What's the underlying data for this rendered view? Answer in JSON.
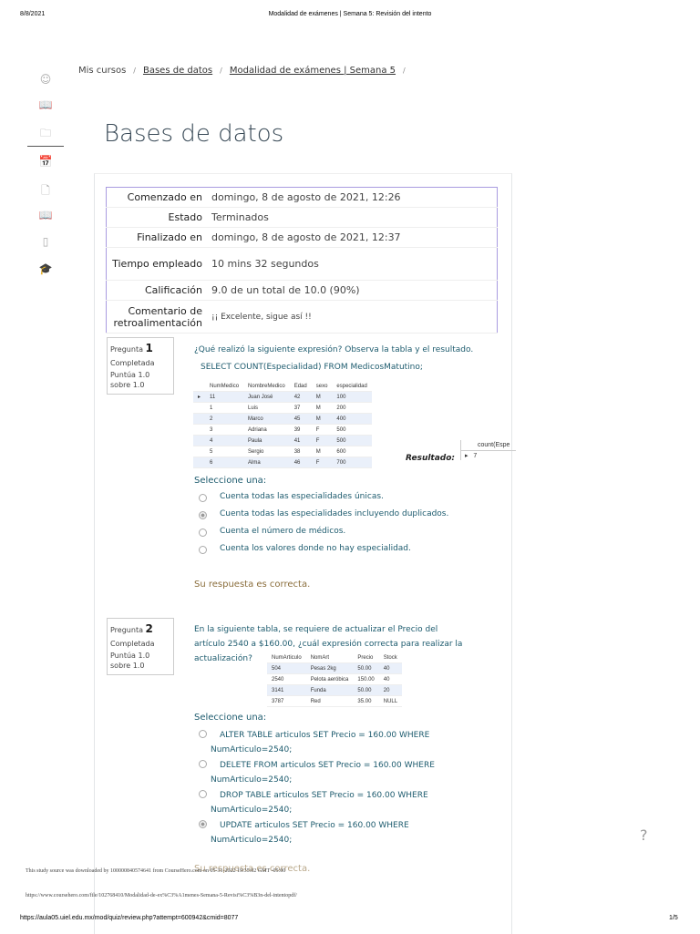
{
  "header": {
    "date": "8/8/2021",
    "title": "Modalidad de exámenes | Semana 5: Revisión del intento"
  },
  "breadcrumb": [
    "Mis cursos",
    "Bases de datos",
    "Modalidad de exámenes | Semana 5"
  ],
  "sidebar_icons": [
    "user-icon",
    "book-icon",
    "folder-icon",
    "calendar-icon",
    "files-icon",
    "library-icon",
    "mobile-icon",
    "graduation-cap-icon"
  ],
  "page_title": "Bases de datos",
  "summary": [
    {
      "k": "Comenzado en",
      "v": "domingo, 8 de agosto de 2021, 12:26"
    },
    {
      "k": "Estado",
      "v": "Terminados"
    },
    {
      "k": "Finalizado en",
      "v": "domingo, 8 de agosto de 2021, 12:37"
    },
    {
      "k": "Tiempo empleado",
      "v": "10 mins 32 segundos"
    },
    {
      "k": "Calificación",
      "v": "9.0 de un total de 10.0 (90%)"
    },
    {
      "k": "Comentario de retroalimentación",
      "v": "¡¡ Excelente, sigue así !!"
    }
  ],
  "q1": {
    "label": "Pregunta",
    "num": "1",
    "status": "Completada",
    "score": "Puntúa 1.0 sobre 1.0",
    "text": "¿Qué realizó la siguiente expresión? Observa la tabla y el resultado.",
    "sql": "SELECT COUNT(Especialidad)  FROM MedicosMatutino;",
    "headers": [
      "NumMedico",
      "NombreMedico",
      "Edad",
      "sexo",
      "especialidad"
    ],
    "rows": [
      [
        "11",
        "Juan José",
        "42",
        "M",
        "100"
      ],
      [
        "1",
        "Luis",
        "37",
        "M",
        "200"
      ],
      [
        "2",
        "Marco",
        "45",
        "M",
        "400"
      ],
      [
        "3",
        "Adriana",
        "39",
        "F",
        "500"
      ],
      [
        "4",
        "Paula",
        "41",
        "F",
        "500"
      ],
      [
        "5",
        "Sergio",
        "38",
        "M",
        "600"
      ],
      [
        "6",
        "Alma",
        "46",
        "F",
        "700"
      ]
    ],
    "result_label": "Resultado:",
    "result_header": "count(Espe",
    "result_value": "7",
    "select": "Seleccione una:",
    "options": [
      "Cuenta todas las especialidades únicas.",
      "Cuenta todas las especialidades incluyendo duplicados.",
      "Cuenta el número de médicos.",
      "Cuenta los valores donde no hay especialidad."
    ],
    "selected": 1,
    "feedback": "Su respuesta es correcta."
  },
  "q2": {
    "label": "Pregunta",
    "num": "2",
    "status": "Completada",
    "score": "Puntúa 1.0 sobre 1.0",
    "text": "En la siguiente tabla, se requiere de actualizar el Precio del artículo 2540 a $160.00, ¿cuál expresión correcta para realizar la actualización?",
    "headers": [
      "NumArticulo",
      "NomArt",
      "Precio",
      "Stock"
    ],
    "rows": [
      [
        "504",
        "Pesas 2kg",
        "50.00",
        "40"
      ],
      [
        "2540",
        "Pelota aeróbica",
        "150.00",
        "40"
      ],
      [
        "3141",
        "Funda",
        "50.00",
        "20"
      ],
      [
        "3787",
        "Red",
        "35.00",
        "NULL"
      ]
    ],
    "select": "Seleccione una:",
    "options": [
      "ALTER TABLE articulos SET Precio = 160.00 WHERE NumArticulo=2540;",
      "DELETE FROM articulos SET Precio = 160.00 WHERE NumArticulo=2540;",
      "DROP TABLE articulos SET Precio = 160.00 WHERE NumArticulo=2540;",
      "UPDATE articulos SET Precio = 160.00 WHERE NumArticulo=2540;"
    ],
    "selected": 3,
    "feedback": "Su respuesta es correcta."
  },
  "help": "?",
  "footer": {
    "download": "This study source was downloaded by 100000840574641 from CourseHero.com on 05-31-2022 19:35:02 GMT -05:00",
    "coursehero_url": "https://www.coursehero.com/file/102768410/Modalidad-de-ex%C3%A1menes-Semana-5-Revisi%C3%B3n-del-intentopdf/",
    "page_url": "https://aula05.uiel.edu.mx/mod/quiz/review.php?attempt=600942&cmid=8077",
    "page_num": "1/5"
  }
}
